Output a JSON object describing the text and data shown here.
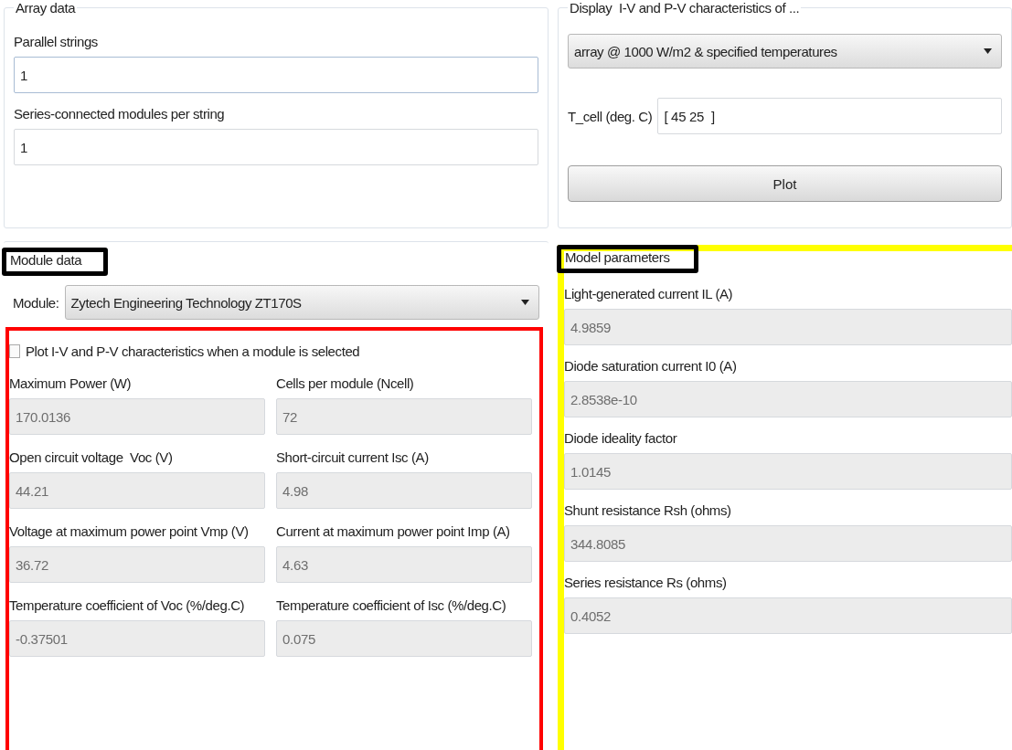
{
  "array_data": {
    "title": "Array data",
    "fields": [
      {
        "label": "Parallel strings",
        "value": "1",
        "focused": true
      },
      {
        "label": "Series-connected modules per string",
        "value": "1",
        "focused": false
      }
    ]
  },
  "display": {
    "title": "Display  I-V and P-V characteristics of ...",
    "dropdown": "array @ 1000 W/m2 & specified temperatures",
    "t_cell": {
      "label": "T_cell (deg. C)",
      "value": "[ 45 25  ]"
    },
    "plot_button": "Plot"
  },
  "module_data": {
    "title": "Module data",
    "module_label": "Module:",
    "module": "Zytech Engineering Technology ZT170S",
    "plot_on_select": {
      "label": "Plot I-V and P-V characteristics when a module is selected",
      "checked": false
    },
    "fields": [
      {
        "label": "Maximum Power (W)",
        "value": "170.0136",
        "disabled": true
      },
      {
        "label": "Cells per module (Ncell)",
        "value": "72",
        "disabled": true
      },
      {
        "label": "Open circuit voltage  Voc (V)",
        "value": "44.21",
        "disabled": true
      },
      {
        "label": "Short-circuit current Isc (A)",
        "value": "4.98",
        "disabled": true
      },
      {
        "label": "Voltage at maximum power point Vmp (V)",
        "value": "36.72",
        "disabled": true
      },
      {
        "label": "Current at maximum power point Imp (A)",
        "value": "4.63",
        "disabled": true
      },
      {
        "label": "Temperature coefficient of Voc (%/deg.C)",
        "value": "-0.37501",
        "disabled": true
      },
      {
        "label": "Temperature coefficient of Isc (%/deg.C)",
        "value": "0.075",
        "disabled": true
      }
    ]
  },
  "model_parameters": {
    "title": "Model parameters",
    "fields": [
      {
        "label": "Light-generated current IL (A)",
        "value": "4.9859",
        "disabled": true
      },
      {
        "label": "Diode saturation current I0 (A)",
        "value": "2.8538e-10",
        "disabled": true
      },
      {
        "label": "Diode ideality factor",
        "value": "1.0145",
        "disabled": true
      },
      {
        "label": "Shunt resistance Rsh (ohms)",
        "value": "344.8085",
        "disabled": true
      },
      {
        "label": "Series resistance Rs (ohms)",
        "value": "0.4052",
        "disabled": true
      }
    ]
  }
}
